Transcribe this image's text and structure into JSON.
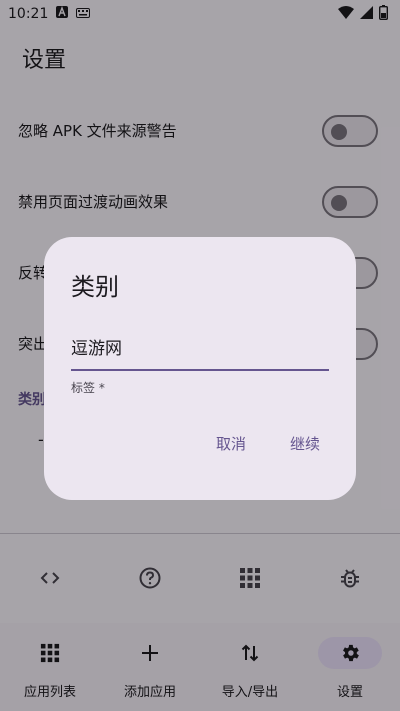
{
  "status_bar": {
    "time": "10:21"
  },
  "app_bar": {
    "title": "设置"
  },
  "settings": [
    {
      "label": "忽略 APK 文件来源警告"
    },
    {
      "label": "禁用页面过渡动画效果"
    },
    {
      "label": "反转"
    },
    {
      "label": "突出"
    }
  ],
  "section": {
    "header": "类别"
  },
  "dash_row": {
    "text": "-"
  },
  "toolbar_icons": [
    "code-icon",
    "help-icon",
    "apps-icon",
    "bug-report-icon"
  ],
  "nav": {
    "items": [
      {
        "label": "应用列表",
        "icon": "apps-icon"
      },
      {
        "label": "添加应用",
        "icon": "add-icon"
      },
      {
        "label": "导入/导出",
        "icon": "import-export-icon"
      },
      {
        "label": "设置",
        "icon": "gear-icon",
        "active": true
      }
    ]
  },
  "dialog": {
    "title": "类别",
    "field_value": "逗游网",
    "field_support": "标签 *",
    "cancel_label": "取消",
    "continue_label": "继续"
  },
  "colors": {
    "accent": "#65558f",
    "surface": "#f7f2fa",
    "dialog_surface": "#ece6f0",
    "nav_active": "#e8def8"
  }
}
